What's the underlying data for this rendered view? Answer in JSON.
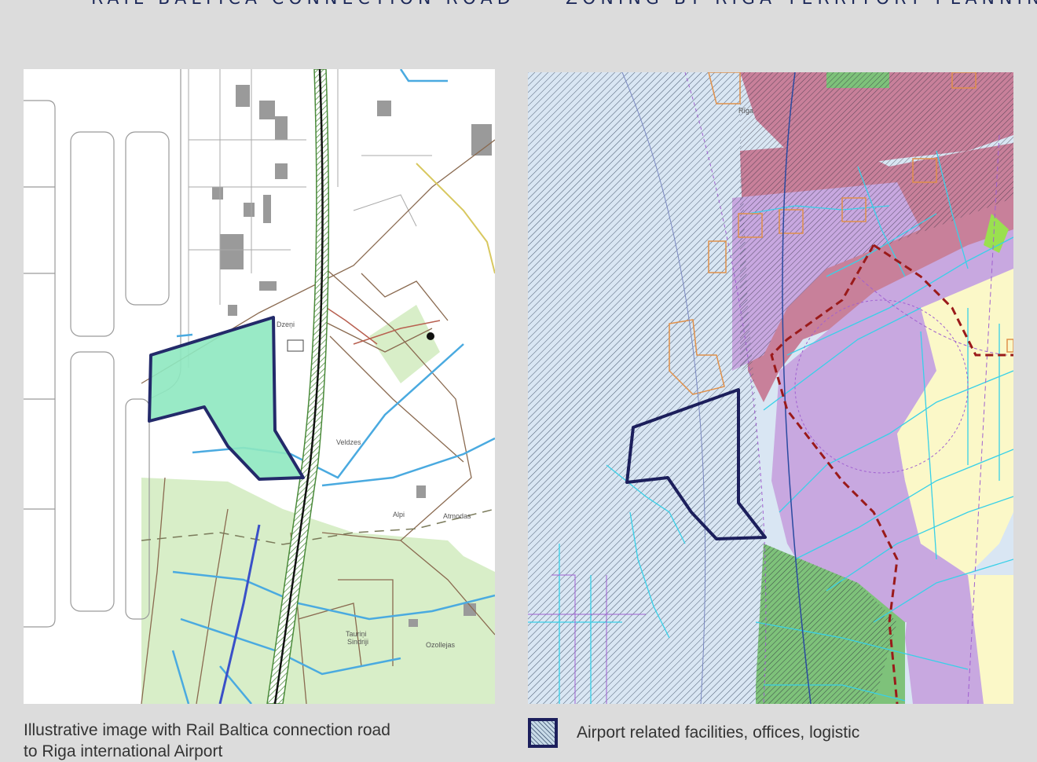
{
  "headings": {
    "left": "RAIL BALTICA CONNECTION ROAD",
    "right": "ZONING BY RIGA TERRITORY PLANNING"
  },
  "left_map": {
    "caption_line1": "Illustrative image with Rail Baltica connection road",
    "caption_line2": "to Riga international Airport",
    "place_labels": [
      "Dzeņi",
      "Veldzes",
      "Atmodas",
      "Alpi",
      "Ozollejas",
      "Tauriņi",
      "Sindriji"
    ],
    "highlight_color": "#8ee8c0",
    "outline_color": "#232a6a"
  },
  "right_map": {
    "place_labels": [
      "Rīga"
    ],
    "legend": {
      "label": "Airport related facilities, offices, logistic",
      "outline_color": "#1c1f5c"
    },
    "zone_colors": {
      "airport": "#d9e6f3",
      "mixed_purple": "#c8a8e0",
      "residential_yellow": "#fbf8c8",
      "green": "#7ec27a",
      "commercial_red": "#c8809a",
      "boundary_dash": "#9a1a1a"
    }
  }
}
